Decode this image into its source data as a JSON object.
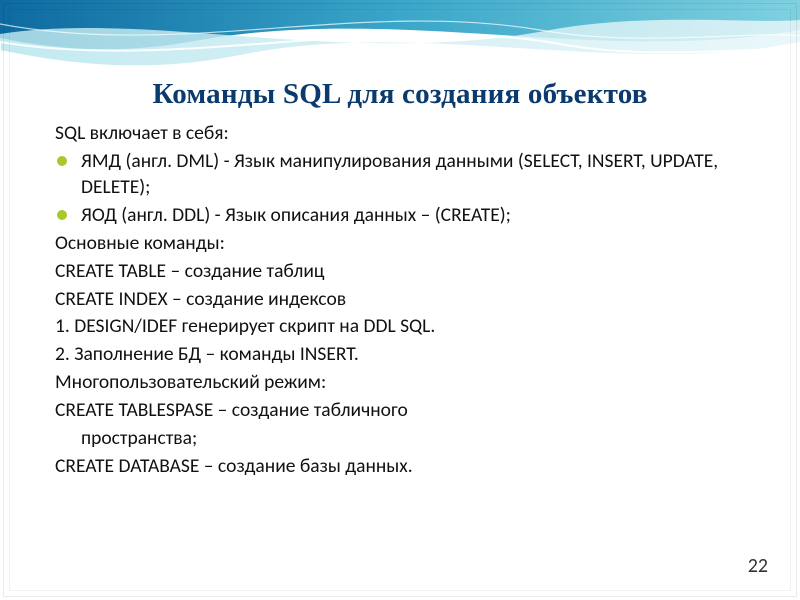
{
  "title": "Команды SQL для создания объектов",
  "lines": {
    "l0": "SQL включает в себя:",
    "b1": "ЯМД (англ. DML) -  Язык манипулирования данными (SELECT, INSERT, UPDATE, DELETE);",
    "b2": "ЯОД (англ. DDL) -   Язык описания данных – (CREATE);",
    "l3": "Основные команды:",
    "l4": "CREATE TABLE – создание таблиц",
    "l5": "CREATE INDEX – создание индексов",
    "l6": "1. DESIGN/IDEF генерирует скрипт на DDL  SQL.",
    "l7": "2. Заполнение БД – команды INSERT.",
    "l8": "Многопользовательский режим:",
    "l9": "CREATE TABLESPASE – создание табличного",
    "l9c": "пространства;",
    "l10": "CREATE DATABASE – создание базы данных."
  },
  "page_number": "22"
}
